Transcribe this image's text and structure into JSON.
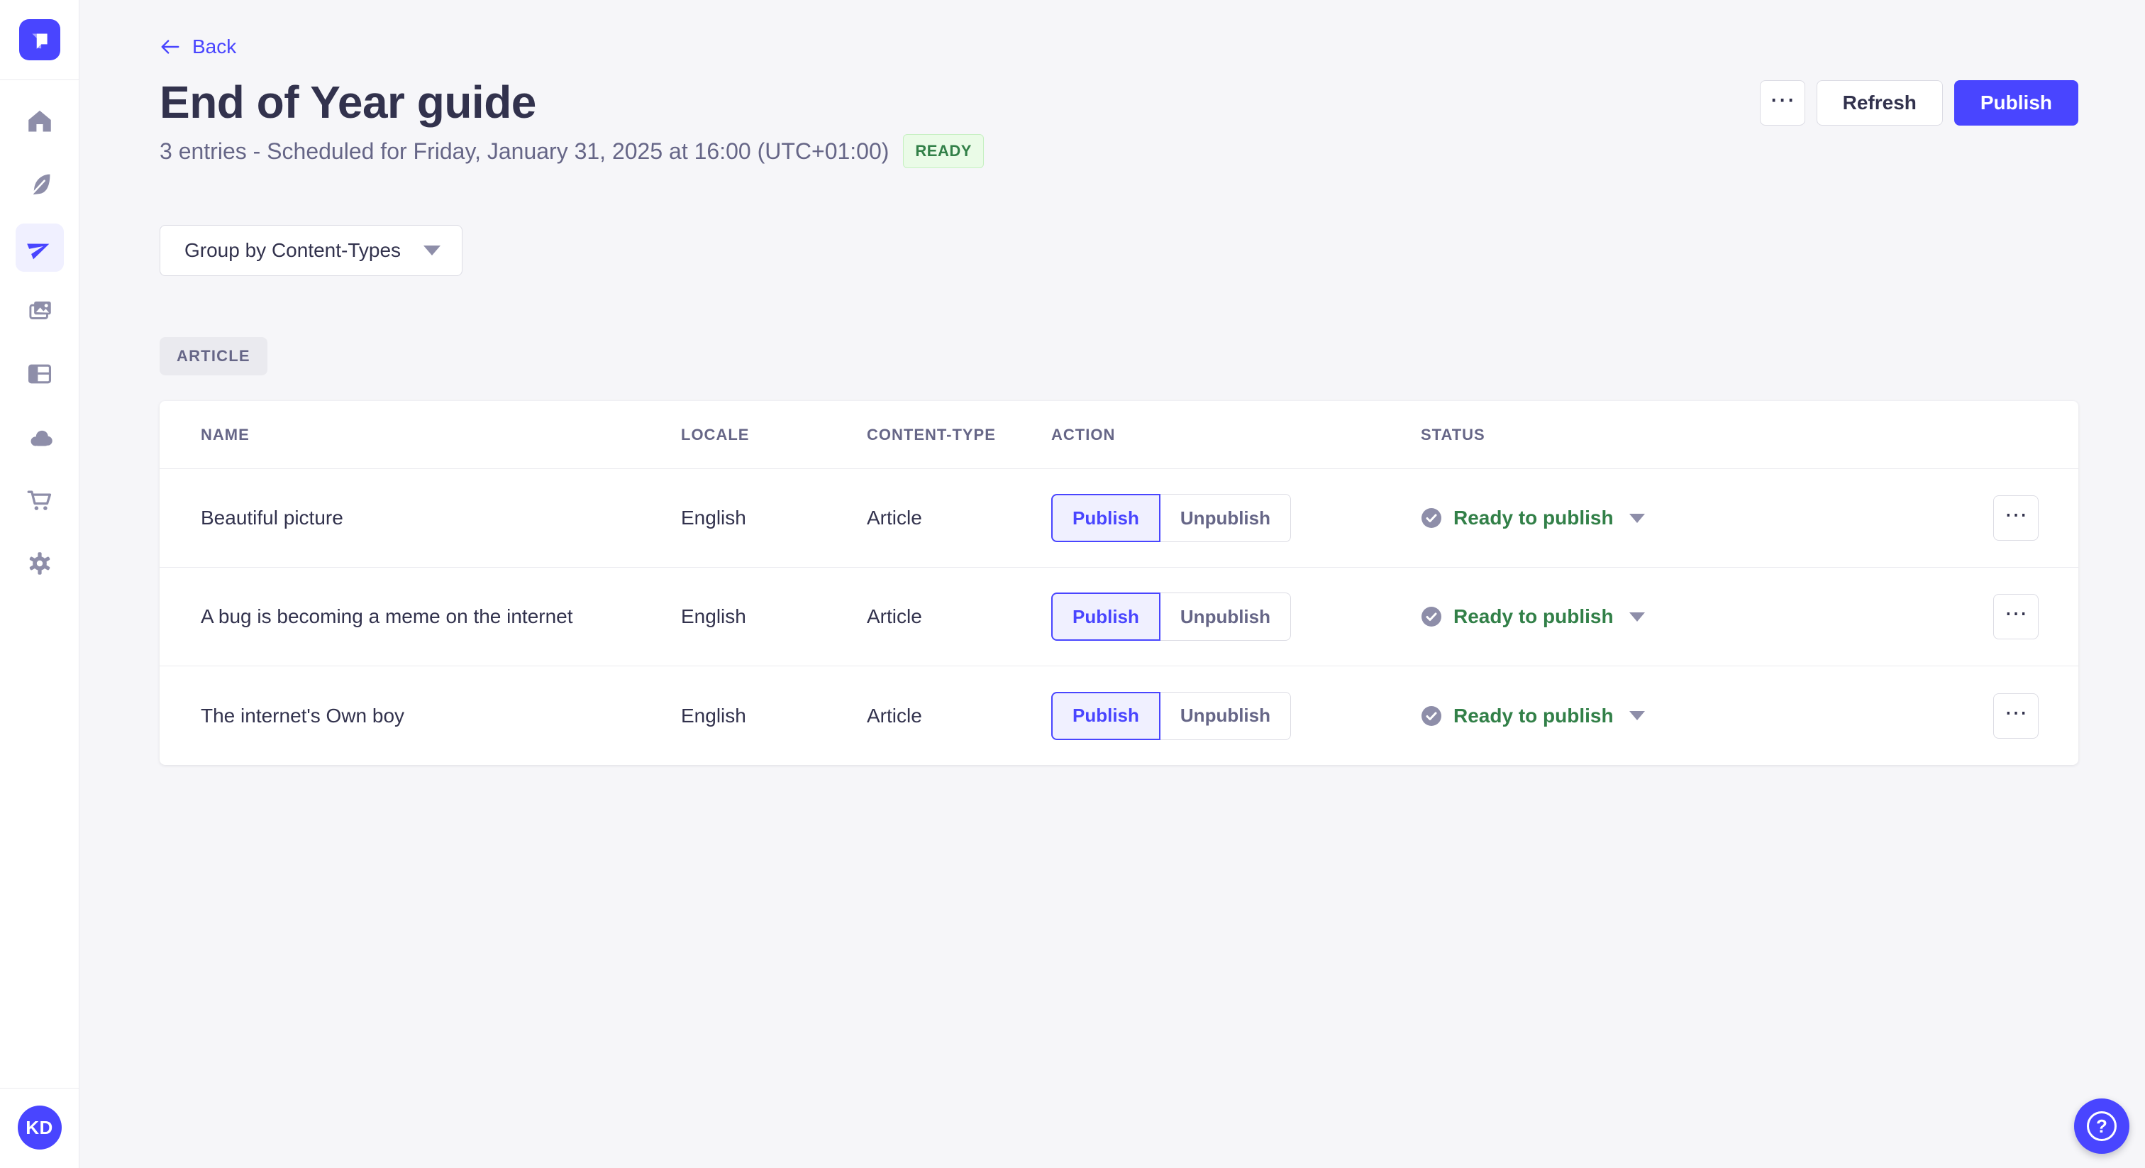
{
  "colors": {
    "accent": "#4945ff",
    "accent_light": "#f0f0ff",
    "success_text": "#328048",
    "success_bg": "#eafbe7",
    "success_border": "#c6f0c2",
    "page_bg": "#f6f6f9",
    "surface": "#ffffff",
    "border": "#dcdce4",
    "divider": "#eaeaef",
    "text": "#32324d",
    "text_muted": "#666687",
    "icon_muted": "#8e8ea9"
  },
  "sidebar": {
    "logo_icon": "strapi-logo",
    "items": [
      {
        "name": "home",
        "icon": "home-icon",
        "active": false
      },
      {
        "name": "content-manager",
        "icon": "feather-icon",
        "active": false
      },
      {
        "name": "releases",
        "icon": "paper-plane-icon",
        "active": true
      },
      {
        "name": "media-library",
        "icon": "images-icon",
        "active": false
      },
      {
        "name": "content-type-builder",
        "icon": "layout-icon",
        "active": false
      },
      {
        "name": "deploy",
        "icon": "cloud-icon",
        "active": false
      },
      {
        "name": "marketplace",
        "icon": "cart-icon",
        "active": false
      },
      {
        "name": "settings",
        "icon": "gear-icon",
        "active": false
      }
    ],
    "avatar_initials": "KD"
  },
  "header": {
    "back_label": "Back",
    "title": "End of Year guide",
    "subtitle": "3 entries - Scheduled for Friday, January 31, 2025 at 16:00 (UTC+01:00)",
    "status_badge": "READY",
    "more_glyph": "⋯",
    "refresh_label": "Refresh",
    "publish_label": "Publish"
  },
  "toolbar": {
    "group_by_label": "Group by Content-Types"
  },
  "group_badge": "ARTICLE",
  "table": {
    "columns": [
      "NAME",
      "LOCALE",
      "CONTENT-TYPE",
      "ACTION",
      "STATUS"
    ],
    "more_glyph": "⋯",
    "rows": [
      {
        "name": "Beautiful picture",
        "locale": "English",
        "content_type": "Article",
        "publish_label": "Publish",
        "unpublish_label": "Unpublish",
        "status": "Ready to publish"
      },
      {
        "name": "A bug is becoming a meme on the internet",
        "locale": "English",
        "content_type": "Article",
        "publish_label": "Publish",
        "unpublish_label": "Unpublish",
        "status": "Ready to publish"
      },
      {
        "name": "The internet's Own boy",
        "locale": "English",
        "content_type": "Article",
        "publish_label": "Publish",
        "unpublish_label": "Unpublish",
        "status": "Ready to publish"
      }
    ]
  },
  "floating": {
    "help_glyph": "?"
  }
}
